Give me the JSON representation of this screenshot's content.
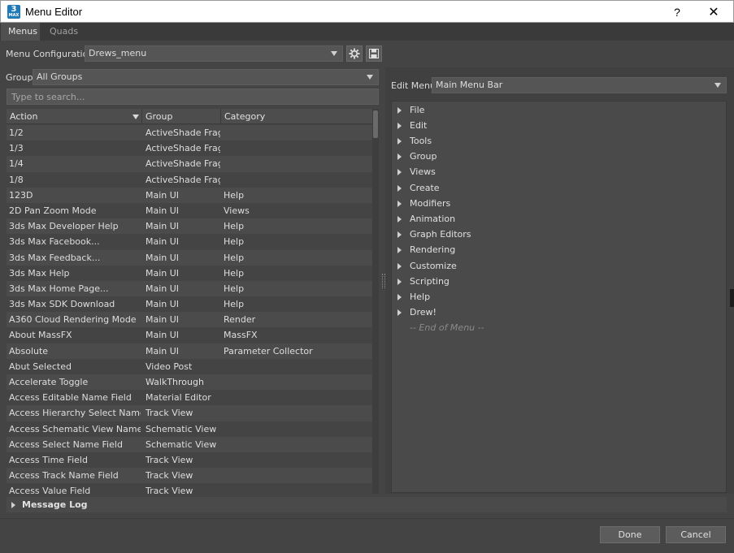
{
  "window": {
    "app_icon": "3",
    "app_icon_sub": "MAX",
    "title": "Menu Editor",
    "help_label": "?",
    "close_label": "✕"
  },
  "tabs": [
    {
      "label": "Menus",
      "active": true
    },
    {
      "label": "Quads",
      "active": false
    }
  ],
  "config": {
    "label": "Menu Configuration",
    "value": "Drews_menu",
    "settings_icon": "gear-icon",
    "save_icon": "save-icon"
  },
  "group": {
    "label": "Group",
    "value": "All Groups"
  },
  "search": {
    "placeholder": "Type to search..."
  },
  "table": {
    "headers": [
      "Action",
      "Group",
      "Category"
    ],
    "rows": [
      [
        "1/2",
        "ActiveShade Frag...",
        ""
      ],
      [
        "1/3",
        "ActiveShade Frag...",
        ""
      ],
      [
        "1/4",
        "ActiveShade Frag...",
        ""
      ],
      [
        "1/8",
        "ActiveShade Frag...",
        ""
      ],
      [
        "123D",
        "Main UI",
        "Help"
      ],
      [
        "2D Pan Zoom Mode",
        "Main UI",
        "Views"
      ],
      [
        "3ds Max Developer Help",
        "Main UI",
        "Help"
      ],
      [
        "3ds Max Facebook...",
        "Main UI",
        "Help"
      ],
      [
        "3ds Max Feedback...",
        "Main UI",
        "Help"
      ],
      [
        "3ds Max Help",
        "Main UI",
        "Help"
      ],
      [
        "3ds Max Home Page...",
        "Main UI",
        "Help"
      ],
      [
        "3ds Max SDK Download",
        "Main UI",
        "Help"
      ],
      [
        "A360 Cloud Rendering Mode",
        "Main UI",
        "Render"
      ],
      [
        "About MassFX",
        "Main UI",
        "MassFX"
      ],
      [
        "Absolute",
        "Main UI",
        "Parameter Collector"
      ],
      [
        "Abut Selected",
        "Video Post",
        ""
      ],
      [
        "Accelerate Toggle",
        "WalkThrough",
        ""
      ],
      [
        "Access Editable Name Field",
        "Material Editor",
        ""
      ],
      [
        "Access Hierarchy Select Name Fi...",
        "Track View",
        ""
      ],
      [
        "Access Schematic View Name Fi...",
        "Schematic View",
        ""
      ],
      [
        "Access Select Name Field",
        "Schematic View",
        ""
      ],
      [
        "Access Time Field",
        "Track View",
        ""
      ],
      [
        "Access Track Name Field",
        "Track View",
        ""
      ],
      [
        "Access Value Field",
        "Track View",
        ""
      ]
    ]
  },
  "edit_menu": {
    "label": "Edit Menu",
    "value": "Main Menu Bar",
    "items": [
      "File",
      "Edit",
      "Tools",
      "Group",
      "Views",
      "Create",
      "Modifiers",
      "Animation",
      "Graph Editors",
      "Rendering",
      "Customize",
      "Scripting",
      "Help",
      "Drew!"
    ],
    "end_label": "-- End of Menu --"
  },
  "message_log": {
    "label": "Message Log"
  },
  "buttons": {
    "done": "Done",
    "cancel": "Cancel"
  }
}
